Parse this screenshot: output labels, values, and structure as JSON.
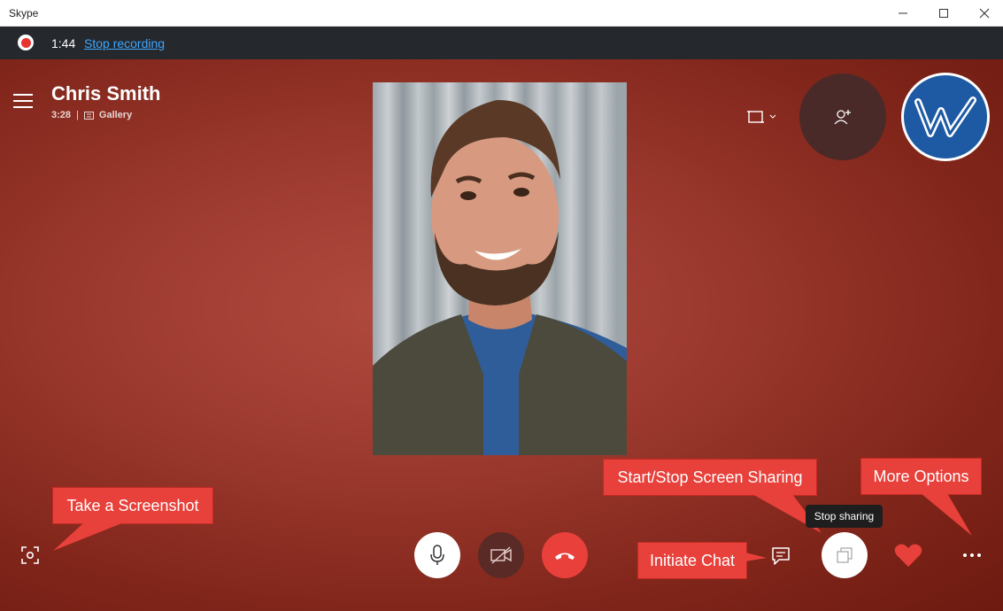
{
  "window": {
    "title": "Skype"
  },
  "recording": {
    "time": "1:44",
    "stop_label": "Stop recording"
  },
  "call": {
    "caller_name": "Chris Smith",
    "duration": "3:28",
    "separator": "|",
    "view_mode": "Gallery"
  },
  "tooltip": {
    "text": "Stop sharing"
  },
  "annotations": {
    "screenshot": "Take a Screenshot",
    "screen_share": "Start/Stop Screen Sharing",
    "chat": "Initiate Chat",
    "more": "More Options"
  },
  "icons": {
    "minimize": "minimize-icon",
    "maximize": "maximize-icon",
    "close": "close-icon",
    "menu": "hamburger-menu-icon",
    "gallery": "gallery-icon",
    "layout": "layout-icon",
    "add_person": "add-person-icon",
    "mic": "microphone-icon",
    "video_off": "video-off-icon",
    "hangup": "hang-up-icon",
    "chat": "chat-icon",
    "share": "screen-share-icon",
    "react": "heart-icon",
    "more": "more-options-icon",
    "screenshot": "screenshot-icon"
  },
  "colors": {
    "accent_link": "#3ea7ff",
    "record_red": "#e8342e",
    "hangup_red": "#e9403b",
    "callout_red": "#e8403a",
    "heart_red": "#e8403a"
  }
}
